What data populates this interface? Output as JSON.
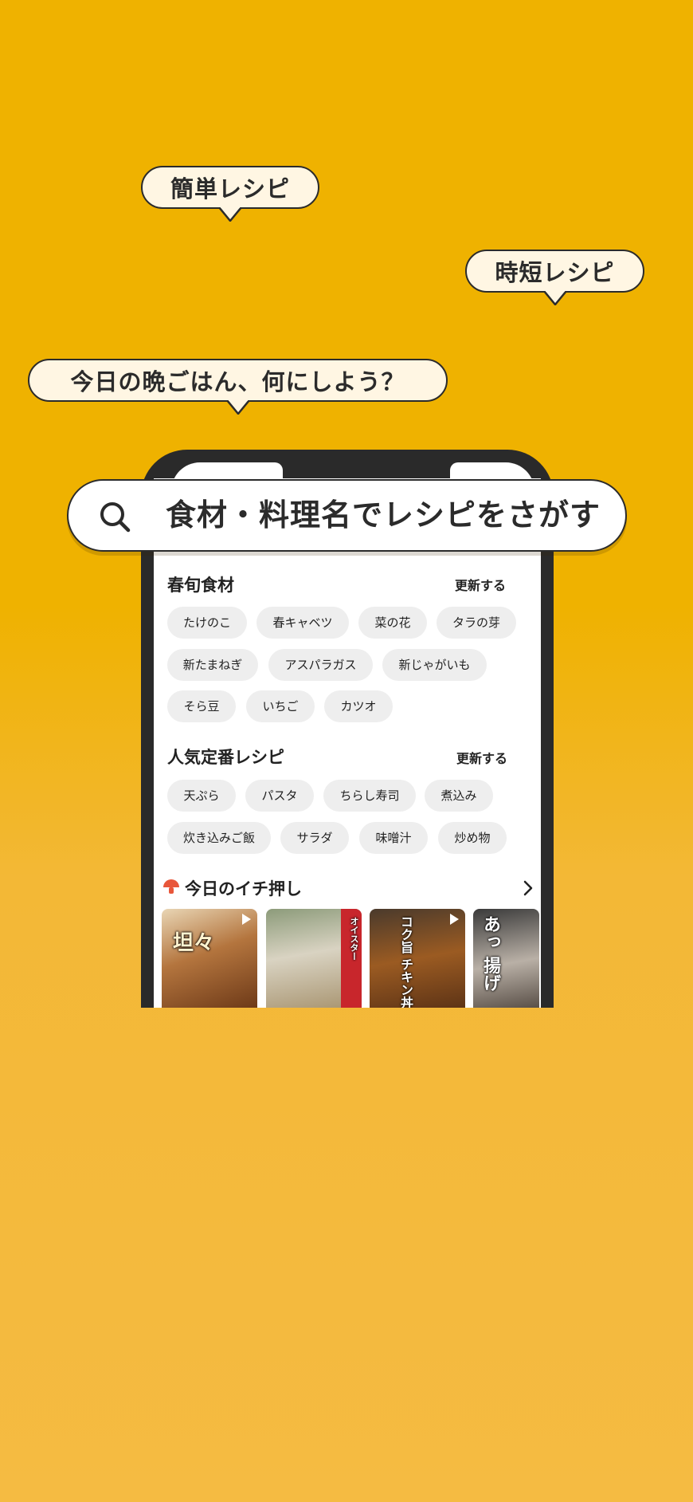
{
  "bubbles": {
    "easy": "簡単レシピ",
    "quick": "時短レシピ",
    "dinner": "今日の晩ごはん、何にしよう？"
  },
  "search": {
    "placeholder": "食材・料理名でレシピをさがす",
    "icon": "search-icon"
  },
  "seasonal": {
    "title": "春旬食材",
    "update_label": "更新する",
    "chips": [
      "たけのこ",
      "春キャベツ",
      "菜の花",
      "タラの芽",
      "新たまねぎ",
      "アスパラガス",
      "新じゃがいも",
      "そら豆",
      "いちご",
      "カツオ"
    ]
  },
  "popular": {
    "title": "人気定番レシピ",
    "update_label": "更新する",
    "chips": [
      "天ぷら",
      "パスタ",
      "ちらし寿司",
      "煮込み",
      "炊き込みご飯",
      "サラダ",
      "味噌汁",
      "炒め物"
    ]
  },
  "pick": {
    "title": "今日のイチ押し",
    "icon": "mushroom-icon",
    "items": [
      {
        "caption": "坦々"
      },
      {
        "caption": "オイスター"
      },
      {
        "caption": "コク旨 チキン丼"
      },
      {
        "caption": "あっ 揚げ"
      }
    ]
  },
  "colors": {
    "background_top": "#EFB200",
    "background_bottom": "#F5BB42",
    "bubble_fill": "#FFF6E3",
    "outline": "#2B2B2B",
    "chip_fill": "#EEEEEE",
    "mushroom": "#E8563A"
  }
}
